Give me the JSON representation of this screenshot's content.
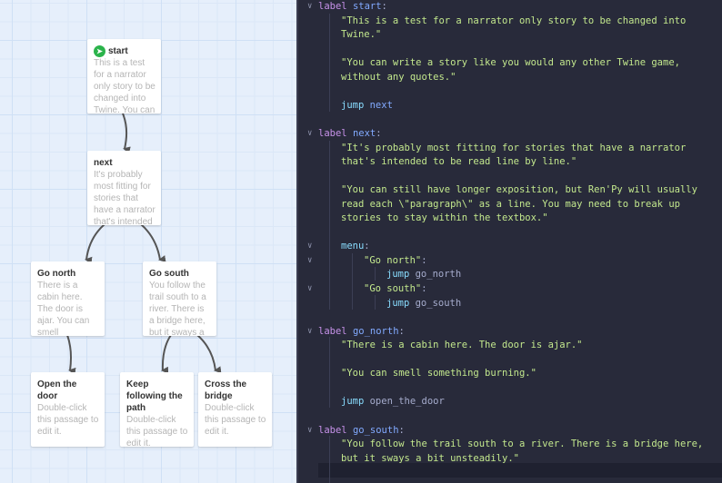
{
  "story_map": {
    "passages": [
      {
        "id": "start",
        "title": "start",
        "excerpt": "This is a test for a narrator only story to be changed into Twine. You can",
        "start": true
      },
      {
        "id": "next",
        "title": "next",
        "excerpt": "It's probably most fitting for stories that have a narrator that's intended"
      },
      {
        "id": "go_north",
        "title": "Go north",
        "excerpt": "There is a cabin here. The door is ajar. You can smell something"
      },
      {
        "id": "go_south",
        "title": "Go south",
        "excerpt": "You follow the trail south to a river. There is a bridge here, but it sways a bit"
      },
      {
        "id": "open_door",
        "title": "Open the door",
        "excerpt": "Double-click this passage to edit it."
      },
      {
        "id": "keep_path",
        "title": "Keep following the path",
        "excerpt": "Double-click this passage to edit it."
      },
      {
        "id": "cross_bridge",
        "title": "Cross the bridge",
        "excerpt": "Double-click this passage to edit it."
      }
    ],
    "start_icon": "rocket-icon"
  },
  "editor": {
    "lines": [
      {
        "row": 0,
        "indent": 0,
        "fold": true,
        "tokens": [
          {
            "text": "label ",
            "c": "kw-label"
          },
          {
            "text": "start",
            "c": "kw-name"
          },
          {
            "text": ":",
            "c": "punc"
          }
        ]
      },
      {
        "row": 1,
        "indent": 1,
        "tokens": [
          {
            "text": "\"This is a test for a narrator only story to be changed into",
            "c": "str"
          }
        ]
      },
      {
        "row": 2,
        "indent": 1,
        "tokens": [
          {
            "text": "Twine.\"",
            "c": "str"
          }
        ]
      },
      {
        "row": 4,
        "indent": 1,
        "tokens": [
          {
            "text": "\"You can write a story like you would any other Twine game,",
            "c": "str"
          }
        ]
      },
      {
        "row": 5,
        "indent": 1,
        "tokens": [
          {
            "text": "without any quotes.\"",
            "c": "str"
          }
        ]
      },
      {
        "row": 7,
        "indent": 1,
        "tokens": [
          {
            "text": "jump ",
            "c": "kw"
          },
          {
            "text": "next",
            "c": "kw-name"
          }
        ]
      },
      {
        "row": 9,
        "indent": 0,
        "fold": true,
        "tokens": [
          {
            "text": "label ",
            "c": "kw-label"
          },
          {
            "text": "next",
            "c": "kw-name"
          },
          {
            "text": ":",
            "c": "punc"
          }
        ]
      },
      {
        "row": 10,
        "indent": 1,
        "tokens": [
          {
            "text": "\"It's probably most fitting for stories that have a narrator",
            "c": "str"
          }
        ]
      },
      {
        "row": 11,
        "indent": 1,
        "tokens": [
          {
            "text": "that's intended to be read line by line.\"",
            "c": "str"
          }
        ]
      },
      {
        "row": 13,
        "indent": 1,
        "tokens": [
          {
            "text": "\"You can still have longer exposition, but Ren'Py will usually",
            "c": "str"
          }
        ]
      },
      {
        "row": 14,
        "indent": 1,
        "tokens": [
          {
            "text": "read each \\\"paragraph\\\" as a line. You may need to break up",
            "c": "str"
          }
        ]
      },
      {
        "row": 15,
        "indent": 1,
        "tokens": [
          {
            "text": "stories to stay within the textbox.\"",
            "c": "str"
          }
        ]
      },
      {
        "row": 17,
        "indent": 1,
        "fold": true,
        "tokens": [
          {
            "text": "menu",
            "c": "kw"
          },
          {
            "text": ":",
            "c": "punc"
          }
        ]
      },
      {
        "row": 18,
        "indent": 2,
        "fold": true,
        "tokens": [
          {
            "text": "\"Go north\"",
            "c": "str"
          },
          {
            "text": ":",
            "c": "punc"
          }
        ]
      },
      {
        "row": 19,
        "indent": 3,
        "tokens": [
          {
            "text": "jump ",
            "c": "kw"
          },
          {
            "text": "go_north",
            "c": "tgt"
          }
        ]
      },
      {
        "row": 20,
        "indent": 2,
        "fold": true,
        "tokens": [
          {
            "text": "\"Go south\"",
            "c": "str"
          },
          {
            "text": ":",
            "c": "punc"
          }
        ]
      },
      {
        "row": 21,
        "indent": 3,
        "tokens": [
          {
            "text": "jump ",
            "c": "kw"
          },
          {
            "text": "go_south",
            "c": "tgt"
          }
        ]
      },
      {
        "row": 23,
        "indent": 0,
        "fold": true,
        "tokens": [
          {
            "text": "label ",
            "c": "kw-label"
          },
          {
            "text": "go_north",
            "c": "kw-name"
          },
          {
            "text": ":",
            "c": "punc"
          }
        ]
      },
      {
        "row": 24,
        "indent": 1,
        "tokens": [
          {
            "text": "\"There is a cabin here. The door is ajar.\"",
            "c": "str"
          }
        ]
      },
      {
        "row": 26,
        "indent": 1,
        "tokens": [
          {
            "text": "\"You can smell something burning.\"",
            "c": "str"
          }
        ]
      },
      {
        "row": 28,
        "indent": 1,
        "tokens": [
          {
            "text": "jump ",
            "c": "kw"
          },
          {
            "text": "open_the_door",
            "c": "tgt"
          }
        ]
      },
      {
        "row": 30,
        "indent": 0,
        "fold": true,
        "tokens": [
          {
            "text": "label ",
            "c": "kw-label"
          },
          {
            "text": "go_south",
            "c": "kw-name"
          },
          {
            "text": ":",
            "c": "punc"
          }
        ]
      },
      {
        "row": 31,
        "indent": 1,
        "tokens": [
          {
            "text": "\"You follow the trail south to a river. There is a bridge here,",
            "c": "str"
          }
        ]
      },
      {
        "row": 32,
        "indent": 1,
        "tokens": [
          {
            "text": "but it sways a bit unsteadily.\"",
            "c": "str"
          }
        ]
      }
    ]
  },
  "colors": {
    "map_bg": "#e6effb",
    "editor_bg": "#282a3a",
    "start_badge": "#2bb34b",
    "keyword_label": "#c792ea",
    "name": "#82aaff",
    "string": "#c3e88d",
    "jump": "#89ddff"
  }
}
